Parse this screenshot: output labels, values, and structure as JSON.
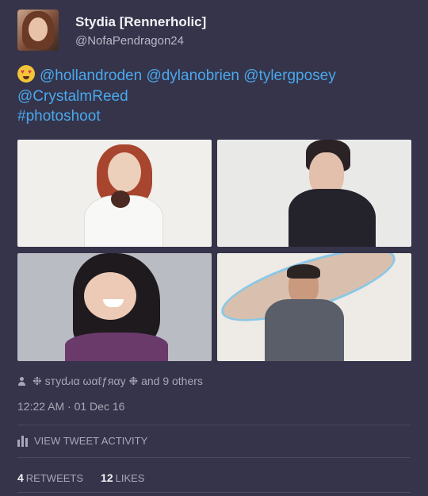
{
  "user": {
    "display_name": "Stydia [Rennerholic]",
    "handle": "@NofaPendragon24",
    "avatar_icon": "profile-photo"
  },
  "tweet": {
    "emoji": "heart-eyes-emoji",
    "mentions": [
      "@hollandroden",
      "@dylanobrien",
      "@tylergposey",
      "@CrystalmReed"
    ],
    "hashtag": "#photoshoot",
    "photos": [
      "photo-1",
      "photo-2",
      "photo-3",
      "photo-4"
    ]
  },
  "likers": {
    "icon": "person-icon",
    "text": "❉ ѕтуԃια ωαℓƒяαу ❉ and 9 others"
  },
  "timestamp": "12:22 AM · 01 Dec 16",
  "activity": {
    "icon": "bar-chart-icon",
    "label": "VIEW TWEET ACTIVITY"
  },
  "stats": {
    "retweets_count": "4",
    "retweets_label": "RETWEETS",
    "likes_count": "12",
    "likes_label": "LIKES"
  },
  "colors": {
    "background": "#35344a",
    "link": "#4aa8ee",
    "muted": "#a9a8b8"
  }
}
